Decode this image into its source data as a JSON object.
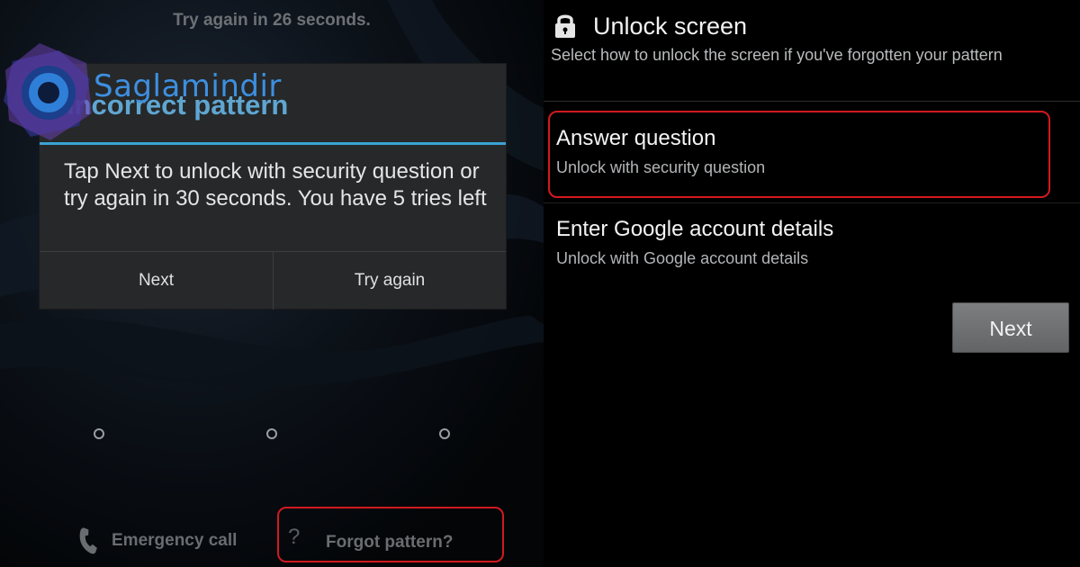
{
  "left_screen": {
    "countdown_text": "Try again in 26 seconds.",
    "watermark": "Saglamindir",
    "dialog": {
      "title": "Incorrect pattern",
      "message": "Tap Next to unlock with security question or try again in 30 seconds. You have 5 tries left",
      "next_label": "Next",
      "try_again_label": "Try again"
    },
    "emergency_call_label": "Emergency call",
    "forgot_pattern_label": "Forgot pattern?",
    "forgot_icon_glyph": "?"
  },
  "right_screen": {
    "title": "Unlock screen",
    "subtitle": "Select how to unlock the screen if you've forgotten your pattern",
    "options": [
      {
        "title": "Answer question",
        "description": "Unlock with security question"
      },
      {
        "title": "Enter Google account details",
        "description": "Unlock with Google account details"
      }
    ],
    "next_label": "Next"
  },
  "colors": {
    "highlight_red": "#d11a1f",
    "dialog_accent": "#3aa3d4",
    "watermark_blue": "#3d8fe0"
  }
}
